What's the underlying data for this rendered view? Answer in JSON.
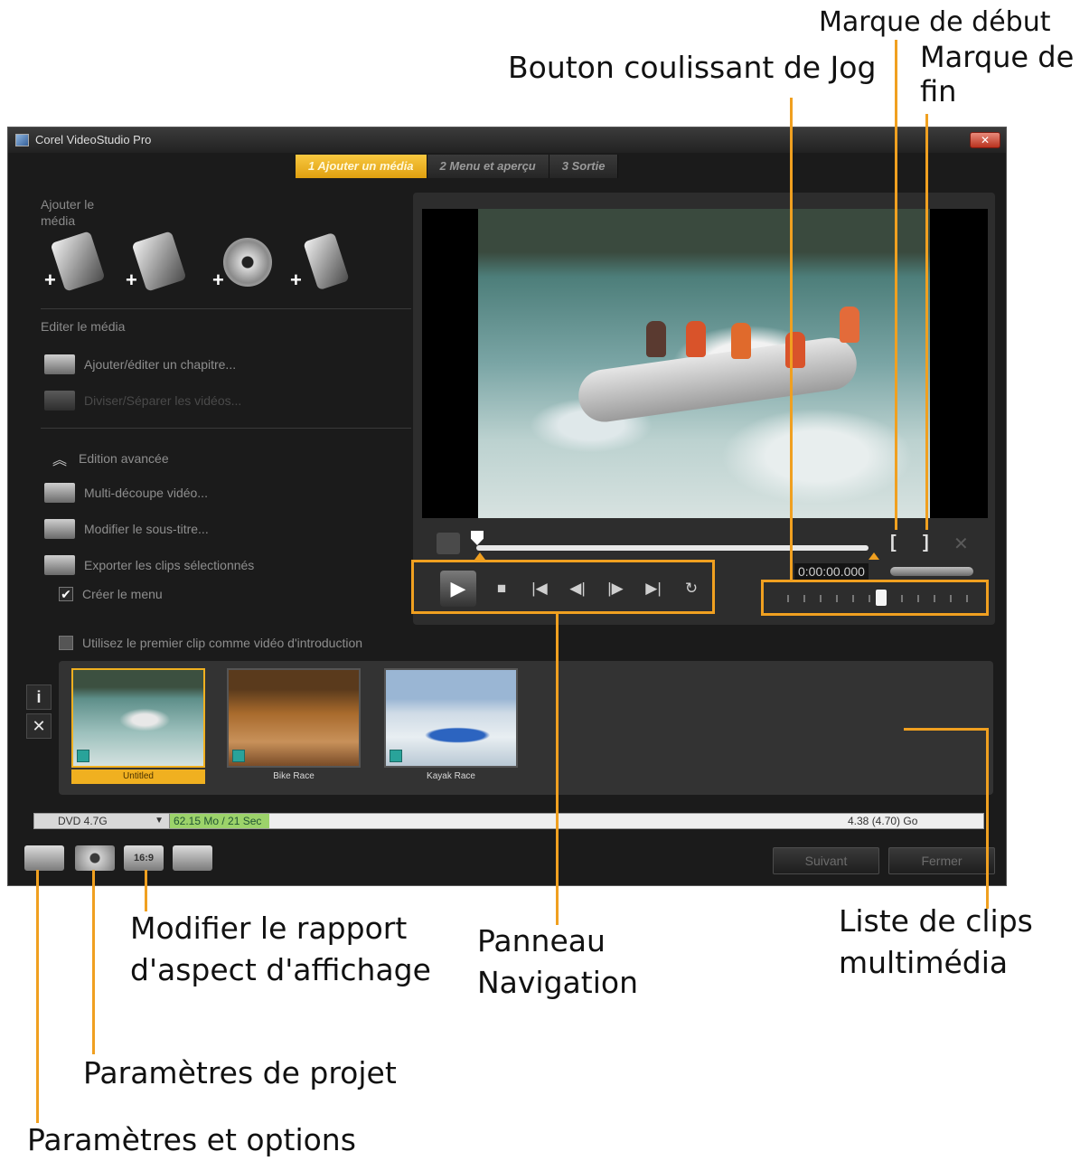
{
  "annotations": {
    "start_mark": "Marque de début",
    "end_mark": "Marque de\nfin",
    "jog_slider": "Bouton coulissant de Jog",
    "aspect_ratio": "Modifier le rapport\nd'aspect d'affichage",
    "navigation_panel": "Panneau\nNavigation",
    "clip_list": "Liste de clips\nmultimédia",
    "project_settings": "Paramètres de projet",
    "settings_options": "Paramètres et options",
    "line_color": "#f0a020"
  },
  "window": {
    "title": "Corel VideoStudio Pro",
    "close_label": "✕",
    "steps": [
      {
        "label": "1 Ajouter un média",
        "active": true
      },
      {
        "label": "2 Menu et aperçu",
        "active": false
      },
      {
        "label": "3 Sortie",
        "active": false
      }
    ]
  },
  "left_panel": {
    "add_media_heading": "Ajouter le\nmédia",
    "edit_media_heading": "Editer le média",
    "add_chapter": "Ajouter/éditer un chapitre...",
    "split_video": "Diviser/Séparer les vidéos...",
    "advanced_editing": "Edition avancée",
    "multi_trim": "Multi-découpe vidéo...",
    "edit_subtitle": "Modifier le sous-titre...",
    "export_clips": "Exporter les clips sélectionnés",
    "create_menu": "Créer le menu",
    "use_first_clip": "Utilisez le premier clip comme vidéo d'introduction"
  },
  "preview": {
    "timecode": "0:00:00.000",
    "mark_in": "[",
    "mark_out": "]",
    "clear_marks": "✕"
  },
  "clips": [
    {
      "name": "Untitled",
      "selected": true
    },
    {
      "name": "Bike Race",
      "selected": false
    },
    {
      "name": "Kayak Race",
      "selected": false
    }
  ],
  "clip_side": {
    "info": "i",
    "delete": "✕"
  },
  "capacity": {
    "disc_type": "DVD 4.7G",
    "used": "62.15 Mo / 21 Sec",
    "total": "4.38 (4.70) Go"
  },
  "buttons": {
    "next": "Suivant",
    "close": "Fermer"
  },
  "icons": {
    "aspect_label": "16:9"
  }
}
